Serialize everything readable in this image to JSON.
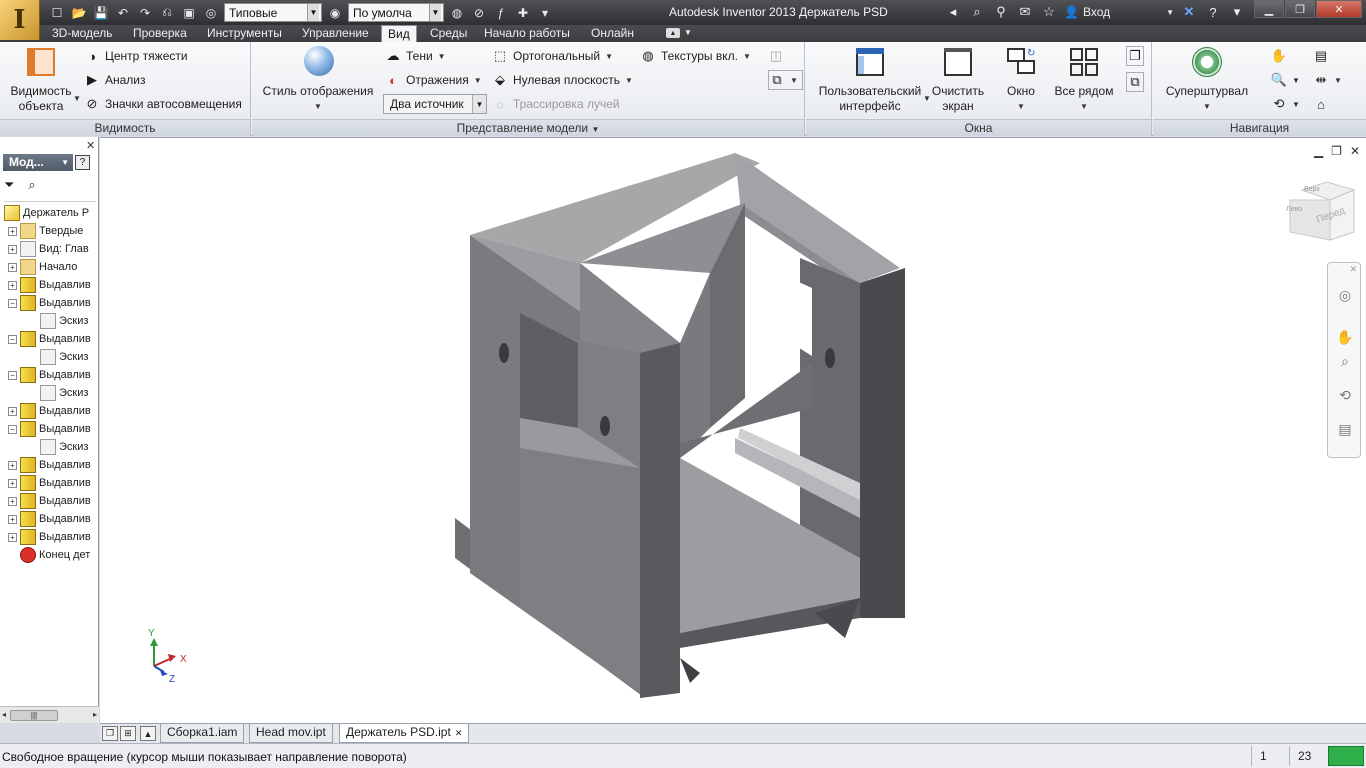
{
  "titlebar": {
    "app_logo": "I",
    "style_combo": "Типовые",
    "appearance_combo": "По умолча",
    "title": "Autodesk Inventor 2013",
    "document": "Держатель PSD",
    "login": "Вход"
  },
  "tabs": [
    "3D-модель",
    "Проверка",
    "Инструменты",
    "Управление",
    "Вид",
    "Среды",
    "Начало работы",
    "Онлайн"
  ],
  "active_tab": "Вид",
  "ribbon": {
    "visibility": {
      "title": "Видимость",
      "object_visibility_l1": "Видимость",
      "object_visibility_l2": "объекта",
      "center_of_gravity": "Центр тяжести",
      "analysis": "Анализ",
      "dof_symbols": "Значки автосовмещения"
    },
    "appearance": {
      "title": "Представление модели",
      "visual_style": "Стиль отображения",
      "shadows": "Тени",
      "reflections": "Отражения",
      "lighting_combo": "Два источник",
      "orthographic": "Ортогональный",
      "ground_plane": "Нулевая плоскость",
      "ray_tracing": "Трассировка лучей",
      "textures": "Текстуры вкл."
    },
    "windows": {
      "title": "Окна",
      "user_interface_l1": "Пользовательский",
      "user_interface_l2": "интерфейс",
      "clean_screen_l1": "Очистить",
      "clean_screen_l2": "экран",
      "window": "Окно",
      "tile": "Все рядом"
    },
    "navigation": {
      "title": "Навигация",
      "steering_wheels": "Суперштурвал"
    }
  },
  "browser": {
    "selector": "Мод...",
    "help": "?",
    "tree": [
      {
        "label": "Держатель P",
        "icon": "part",
        "level": 0,
        "expander": ""
      },
      {
        "label": "Твердые",
        "icon": "folder-solids",
        "level": 1,
        "expander": "+"
      },
      {
        "label": "Вид: Глав",
        "icon": "view",
        "level": 1,
        "expander": "+"
      },
      {
        "label": "Начало",
        "icon": "folder",
        "level": 1,
        "expander": "+"
      },
      {
        "label": "Выдавлив",
        "icon": "extrude",
        "level": 1,
        "expander": "+"
      },
      {
        "label": "Выдавлив",
        "icon": "extrude",
        "level": 1,
        "expander": "−"
      },
      {
        "label": "Эскиз",
        "icon": "sketch",
        "level": 2,
        "expander": ""
      },
      {
        "label": "Выдавлив",
        "icon": "extrude",
        "level": 1,
        "expander": "−"
      },
      {
        "label": "Эскиз",
        "icon": "sketch",
        "level": 2,
        "expander": ""
      },
      {
        "label": "Выдавлив",
        "icon": "extrude",
        "level": 1,
        "expander": "−"
      },
      {
        "label": "Эскиз",
        "icon": "sketch",
        "level": 2,
        "expander": ""
      },
      {
        "label": "Выдавлив",
        "icon": "extrude",
        "level": 1,
        "expander": "+"
      },
      {
        "label": "Выдавлив",
        "icon": "extrude",
        "level": 1,
        "expander": "−"
      },
      {
        "label": "Эскиз",
        "icon": "sketch",
        "level": 2,
        "expander": ""
      },
      {
        "label": "Выдавлив",
        "icon": "extrude",
        "level": 1,
        "expander": "+"
      },
      {
        "label": "Выдавлив",
        "icon": "extrude",
        "level": 1,
        "expander": "+"
      },
      {
        "label": "Выдавлив",
        "icon": "extrude",
        "level": 1,
        "expander": "+"
      },
      {
        "label": "Выдавлив",
        "icon": "extrude",
        "level": 1,
        "expander": "+"
      },
      {
        "label": "Выдавлив",
        "icon": "extrude",
        "level": 1,
        "expander": "+"
      },
      {
        "label": "Конец дет",
        "icon": "end-of-part",
        "level": 1,
        "expander": ""
      }
    ]
  },
  "graphics": {
    "viewcube_face": "Перед",
    "viewcube_top": "Верх",
    "viewcube_left": "Лево",
    "axis_x": "X",
    "axis_y": "Y",
    "axis_z": "Z"
  },
  "doc_tabs": [
    {
      "label": "Сборка1.iam",
      "active": false
    },
    {
      "label": "Head mov.ipt",
      "active": false
    },
    {
      "label": "Держатель PSD.ipt",
      "active": true
    }
  ],
  "status": {
    "message": "Свободное вращение (курсор мыши показывает направление поворота)",
    "count1": "1",
    "count2": "23"
  }
}
